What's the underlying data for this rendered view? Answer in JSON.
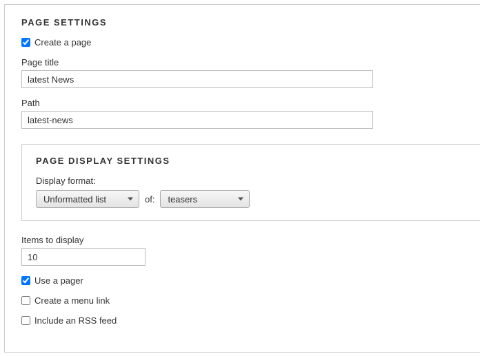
{
  "section_title": "PAGE SETTINGS",
  "create_page": {
    "label": "Create a page",
    "checked": true
  },
  "page_title": {
    "label": "Page title",
    "value": "latest News"
  },
  "path": {
    "label": "Path",
    "value": "latest-news"
  },
  "display_settings": {
    "title": "PAGE DISPLAY SETTINGS",
    "format_label": "Display format:",
    "format_value": "Unformatted list",
    "of_text": "of:",
    "row_style_value": "teasers"
  },
  "items_to_display": {
    "label": "Items to display",
    "value": "10"
  },
  "use_pager": {
    "label": "Use a pager",
    "checked": true
  },
  "menu_link": {
    "label": "Create a menu link",
    "checked": false
  },
  "rss_feed": {
    "label": "Include an RSS feed",
    "checked": false
  }
}
